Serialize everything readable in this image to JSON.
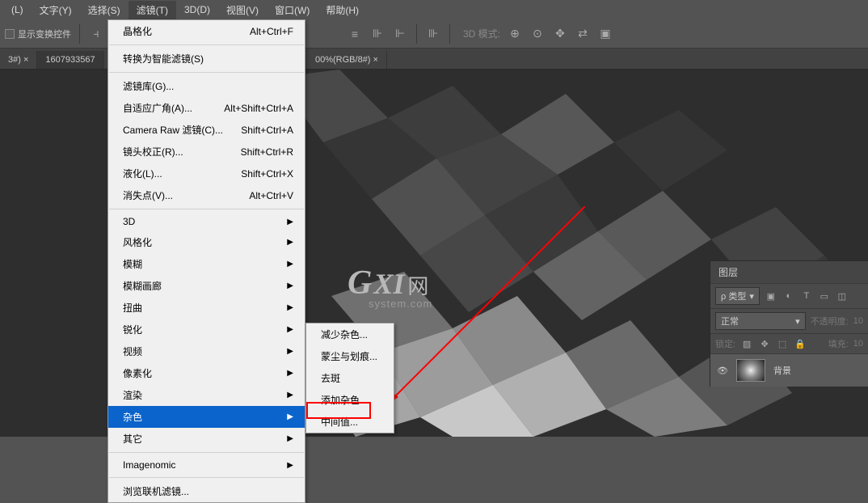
{
  "menubar": {
    "items": [
      "(L)",
      "文字(Y)",
      "选择(S)",
      "滤镜(T)",
      "3D(D)",
      "视图(V)",
      "窗口(W)",
      "帮助(H)"
    ],
    "activeIndex": 3
  },
  "optionsbar": {
    "checkbox_label": "显示变换控件",
    "mode_label": "3D 模式:"
  },
  "tabs": {
    "items": [
      {
        "label": "3#) ×"
      },
      {
        "label": "1607933567"
      },
      {
        "label": "00%(RGB/8#) ×"
      }
    ]
  },
  "filterMenu": {
    "top": {
      "label": "晶格化",
      "shortcut": "Alt+Ctrl+F"
    },
    "convert": {
      "label": "转换为智能滤镜(S)"
    },
    "group1": [
      {
        "label": "滤镜库(G)...",
        "shortcut": ""
      },
      {
        "label": "自适应广角(A)...",
        "shortcut": "Alt+Shift+Ctrl+A"
      },
      {
        "label": "Camera Raw 滤镜(C)...",
        "shortcut": "Shift+Ctrl+A"
      },
      {
        "label": "镜头校正(R)...",
        "shortcut": "Shift+Ctrl+R"
      },
      {
        "label": "液化(L)...",
        "shortcut": "Shift+Ctrl+X"
      },
      {
        "label": "消失点(V)...",
        "shortcut": "Alt+Ctrl+V"
      }
    ],
    "group2": [
      {
        "label": "3D",
        "sub": true
      },
      {
        "label": "风格化",
        "sub": true
      },
      {
        "label": "模糊",
        "sub": true
      },
      {
        "label": "模糊画廊",
        "sub": true
      },
      {
        "label": "扭曲",
        "sub": true
      },
      {
        "label": "锐化",
        "sub": true
      },
      {
        "label": "视频",
        "sub": true
      },
      {
        "label": "像素化",
        "sub": true
      },
      {
        "label": "渲染",
        "sub": true
      },
      {
        "label": "杂色",
        "sub": true,
        "hi": true
      },
      {
        "label": "其它",
        "sub": true
      }
    ],
    "group3": {
      "label": "Imagenomic",
      "sub": true
    },
    "group4": {
      "label": "浏览联机滤镜..."
    }
  },
  "noiseSubmenu": {
    "items": [
      "减少杂色...",
      "蒙尘与划痕...",
      "去斑",
      "添加杂色...",
      "中间值..."
    ]
  },
  "watermark": {
    "g": "G",
    "xi": "XI",
    "net": "网",
    "sys": "system.com"
  },
  "layers": {
    "title": "图层",
    "kind": "ρ 类型",
    "blend": "正常",
    "opacity_label": "不透明度:",
    "opacity_val": "10",
    "lock_label": "锁定:",
    "fill_label": "填充:",
    "fill_val": "10",
    "item_name": "背景"
  }
}
